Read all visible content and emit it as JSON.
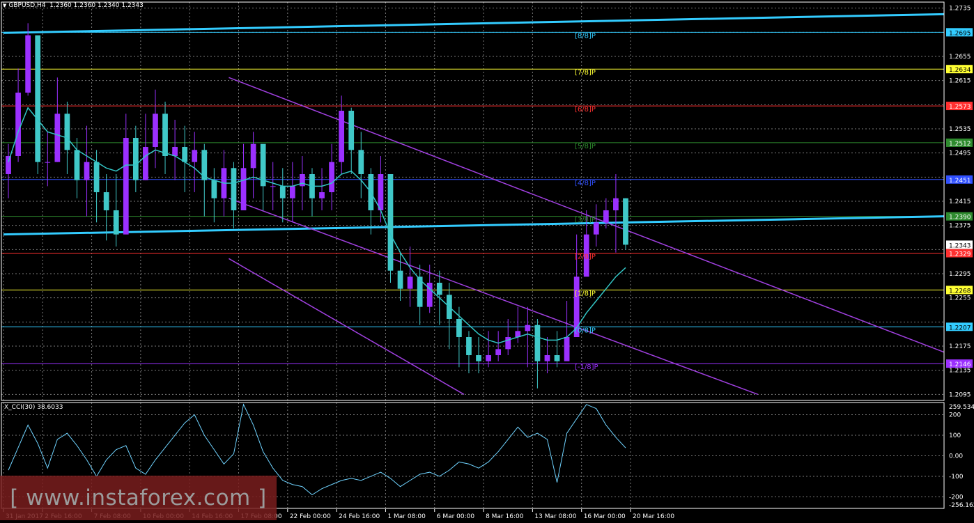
{
  "header": {
    "symbol": "GBPUSD,H4",
    "ohlc": "1.2360 1.2360 1.2340 1.2343"
  },
  "indicator": {
    "label": "X_CCI(30) 38.6033"
  },
  "watermark": {
    "text": "[ www.instaforex.com ]"
  },
  "colors": {
    "background": "#000000",
    "bull_candle": "#9b30ff",
    "bear_candle": "#40c8c8",
    "ma": "#33c6c6",
    "trendline": "#33ccff",
    "channel": "#a040e0",
    "cci_line": "#6fd3ff",
    "grid": "#7a7a7a"
  },
  "chart_data": [
    {
      "type": "candlestick",
      "series": [
        {
          "name": "GBPUSD,H4",
          "close": [
            1.249,
            1.2595,
            1.269,
            1.248,
            1.248,
            1.256,
            1.25,
            1.245,
            1.248,
            1.243,
            1.24,
            1.236,
            1.252,
            1.245,
            1.2505,
            1.256,
            1.249,
            1.2505,
            1.248,
            1.25,
            1.245,
            1.242,
            1.247,
            1.24,
            1.247,
            1.251,
            1.244,
            1.244,
            1.242,
            1.244,
            1.246,
            1.242,
            1.243,
            1.248,
            1.2565,
            1.25,
            1.246,
            1.24,
            1.246,
            1.23,
            1.227,
            1.229,
            1.224,
            1.228,
            1.226,
            1.222,
            1.219,
            1.216,
            1.215,
            1.216,
            1.217,
            1.219,
            1.22,
            1.221,
            1.215,
            1.216,
            1.215,
            1.219,
            1.229,
            1.236,
            1.238,
            1.24,
            1.242,
            1.2343
          ],
          "high": [
            1.251,
            1.2635,
            1.271,
            1.256,
            1.253,
            1.262,
            1.258,
            1.252,
            1.254,
            1.25,
            1.246,
            1.246,
            1.256,
            1.254,
            1.256,
            1.26,
            1.258,
            1.255,
            1.254,
            1.253,
            1.251,
            1.247,
            1.25,
            1.248,
            1.251,
            1.253,
            1.25,
            1.248,
            1.247,
            1.248,
            1.249,
            1.247,
            1.247,
            1.251,
            1.259,
            1.257,
            1.253,
            1.247,
            1.249,
            1.244,
            1.233,
            1.234,
            1.231,
            1.231,
            1.23,
            1.228,
            1.224,
            1.22,
            1.219,
            1.22,
            1.22,
            1.222,
            1.224,
            1.224,
            1.222,
            1.219,
            1.22,
            1.225,
            1.236,
            1.24,
            1.241,
            1.242,
            1.246,
            1.242
          ],
          "low": [
            1.242,
            1.248,
            1.259,
            1.246,
            1.244,
            1.248,
            1.246,
            1.242,
            1.239,
            1.238,
            1.235,
            1.234,
            1.244,
            1.243,
            1.245,
            1.247,
            1.246,
            1.245,
            1.243,
            1.243,
            1.239,
            1.238,
            1.239,
            1.237,
            1.241,
            1.242,
            1.24,
            1.24,
            1.238,
            1.238,
            1.24,
            1.239,
            1.24,
            1.24,
            1.246,
            1.246,
            1.242,
            1.236,
            1.238,
            1.228,
            1.225,
            1.224,
            1.221,
            1.223,
            1.221,
            1.217,
            1.214,
            1.213,
            1.213,
            1.214,
            1.215,
            1.216,
            1.218,
            1.214,
            1.2105,
            1.213,
            1.214,
            1.216,
            1.224,
            1.233,
            1.234,
            1.237,
            1.233,
            1.2335
          ]
        }
      ],
      "ma": [
        1.248,
        1.253,
        1.257,
        1.255,
        1.253,
        1.2525,
        1.252,
        1.25,
        1.249,
        1.248,
        1.247,
        1.2465,
        1.2475,
        1.2475,
        1.249,
        1.25,
        1.2495,
        1.249,
        1.248,
        1.247,
        1.2455,
        1.245,
        1.2445,
        1.2445,
        1.245,
        1.2455,
        1.245,
        1.2445,
        1.244,
        1.244,
        1.2445,
        1.244,
        1.244,
        1.2445,
        1.246,
        1.2465,
        1.245,
        1.243,
        1.24,
        1.236,
        1.233,
        1.2305,
        1.2285,
        1.227,
        1.2255,
        1.224,
        1.2225,
        1.221,
        1.2195,
        1.2185,
        1.218,
        1.2185,
        1.219,
        1.2195,
        1.219,
        1.2185,
        1.2185,
        1.219,
        1.2205,
        1.223,
        1.225,
        1.227,
        1.229,
        1.2305
      ],
      "x_labels": [
        "31 Jan 2017",
        "2 Feb 16:00",
        "7 Feb 08:00",
        "10 Feb 00:00",
        "14 Feb 16:00",
        "17 Feb 08:00",
        "22 Feb 00:00",
        "24 Feb 16:00",
        "1 Mar 08:00",
        "6 Mar 00:00",
        "8 Mar 16:00",
        "13 Mar 08:00",
        "16 Mar 00:00",
        "20 Mar 16:00"
      ],
      "x_label_index": [
        0,
        4,
        9,
        14,
        19,
        24,
        29,
        34,
        39,
        44,
        49,
        54,
        59,
        64
      ],
      "y_ticks": [
        1.2735,
        1.2695,
        1.2655,
        1.2615,
        1.2575,
        1.2535,
        1.2495,
        1.2455,
        1.2415,
        1.2375,
        1.2335,
        1.2295,
        1.2255,
        1.2215,
        1.2175,
        1.2135,
        1.2095
      ],
      "ylim": [
        1.2085,
        1.2745
      ],
      "price_label": 1.2343,
      "murrey_levels": [
        {
          "label": "[8/8]P",
          "price": 1.2695,
          "price_text": "1.2695",
          "color": "#33ccff"
        },
        {
          "label": "[7/8]P",
          "price": 1.2634,
          "price_text": "1.2634",
          "color": "#ffff33"
        },
        {
          "label": "[6/8]P",
          "price": 1.2573,
          "price_text": "1.2573",
          "color": "#ff3030"
        },
        {
          "label": "[5/8]P",
          "price": 1.2512,
          "price_text": "1.2512",
          "color": "#2e8b2e"
        },
        {
          "label": "[4/8]P",
          "price": 1.2451,
          "price_text": "1.2451",
          "color": "#3050ff"
        },
        {
          "label": "[3/8]P",
          "price": 1.239,
          "price_text": "1.2390",
          "color": "#2e8b2e"
        },
        {
          "label": "[2/8]P",
          "price": 1.2329,
          "price_text": "1.2329",
          "color": "#ff3030"
        },
        {
          "label": "[1/8]P",
          "price": 1.2268,
          "price_text": "1.2268",
          "color": "#ffff33"
        },
        {
          "label": "[0/8]P",
          "price": 1.2207,
          "price_text": "1.2207",
          "color": "#33ccff"
        },
        {
          "label": "[-1/8]P",
          "price": 1.2146,
          "price_text": "1.2146",
          "color": "#9b30ff"
        }
      ],
      "trendlines": [
        {
          "from": [
            0,
            1.236
          ],
          "to": [
            96,
            1.239
          ],
          "color": "#33ccff"
        },
        {
          "from": [
            0,
            1.2694
          ],
          "to": [
            96,
            1.2725
          ],
          "color": "#33ccff"
        }
      ],
      "channel": [
        {
          "from": [
            23,
            1.262
          ],
          "to": [
            96,
            1.2165
          ]
        },
        {
          "from": [
            23,
            1.242
          ],
          "to": [
            77,
            1.2095
          ]
        },
        {
          "from": [
            23,
            1.232
          ],
          "to": [
            47,
            1.2095
          ]
        }
      ]
    },
    {
      "type": "line",
      "series": [
        {
          "name": "X_CCI(30)",
          "values": [
            -70,
            40,
            150,
            60,
            -60,
            80,
            110,
            50,
            -20,
            -100,
            -20,
            30,
            50,
            -60,
            -90,
            -20,
            40,
            100,
            160,
            200,
            100,
            30,
            -40,
            10,
            250,
            150,
            20,
            -60,
            -120,
            -140,
            -150,
            -190,
            -160,
            -140,
            -120,
            -110,
            -120,
            -100,
            -80,
            -110,
            -150,
            -120,
            -90,
            -80,
            -100,
            -70,
            -30,
            -40,
            -60,
            -30,
            20,
            80,
            140,
            90,
            110,
            80,
            -130,
            110,
            180,
            250,
            230,
            150,
            90,
            38.6
          ]
        }
      ],
      "y_ticks": [
        259.534,
        200,
        100,
        0.0,
        -100,
        -200,
        -256.162
      ],
      "y_tick_labels": [
        "259.534",
        "200",
        "100",
        "0.00",
        "-100",
        "-200",
        "-256.162"
      ],
      "ylim": [
        -256.162,
        259.534
      ]
    }
  ]
}
